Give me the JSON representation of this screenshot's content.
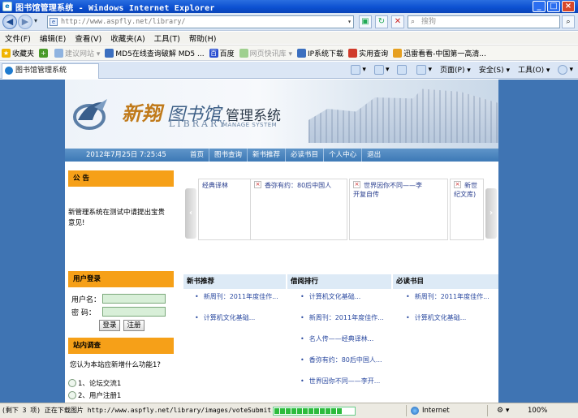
{
  "window": {
    "title": "图书馆管理系统 - Windows Internet Explorer"
  },
  "address": {
    "url": "http://www.aspfly.net/library/",
    "search_placeholder": "搜狗"
  },
  "menu": [
    "文件(F)",
    "编辑(E)",
    "查看(V)",
    "收藏夹(A)",
    "工具(T)",
    "帮助(H)"
  ],
  "favorites": {
    "label": "收藏夹",
    "items": [
      "建议网站 ▾",
      "MD5在线查询破解 MD5 ...",
      "百度",
      "网页快讯库 ▾",
      "IP系统下载",
      "实用查询",
      "迅雷看看-中国第一高清..."
    ]
  },
  "tab": {
    "label": "图书馆管理系统"
  },
  "commands": [
    "页面(P) ▾",
    "安全(S) ▾",
    "工具(O) ▾"
  ],
  "site": {
    "brand_main": "新翔",
    "brand_library": "图书馆",
    "brand_system": "管理系统",
    "sub_library": "LIBRARY",
    "sub_manage": "MANAGE SYSTEM",
    "date": "2012年7月25日  7:25:45",
    "nav": [
      "首页",
      "图书查询",
      "新书推荐",
      "必读书目",
      "个人中心",
      "退出"
    ]
  },
  "notice": {
    "title": "公  告",
    "body": "新管理系统在测试中请提出宝贵意见!"
  },
  "slider": {
    "left_arrow": "‹",
    "right_arrow": "›",
    "cards": [
      "经典译林",
      "香弥有约：80后中国人",
      "世界因你不同——李开复自传",
      "新世纪文库)"
    ]
  },
  "login": {
    "title": "用户登录",
    "username_label": "用户名：",
    "password_label": "密  码：",
    "login_button": "登录",
    "register_button": "注册"
  },
  "survey": {
    "title": "站内调查",
    "question": "您认为本站应新增什么功能1?",
    "options": [
      "1、论坛交流1",
      "2、用户注册1"
    ]
  },
  "columns": {
    "new_books": {
      "title": "新书推荐",
      "items": [
        "新周刊：2011年度佳作...",
        "计算机文化基础..."
      ]
    },
    "ranking": {
      "title": "借阅排行",
      "items": [
        "计算机文化基础...",
        "新周刊：2011年度佳作...",
        "名人传——经典译林...",
        "香弥有约：80后中国人...",
        "世界因你不同——李开..."
      ]
    },
    "must_read": {
      "title": "必读书目",
      "items": [
        "新周刊：2011年度佳作...",
        "计算机文化基础..."
      ]
    }
  },
  "status": {
    "text": "(剩下 3 项) 正在下载图片 http://www.aspfly.net/library/images/voteSubmit.gif...",
    "zone": "Internet",
    "zoom": "100%",
    "progress_fraction": 0.85
  }
}
